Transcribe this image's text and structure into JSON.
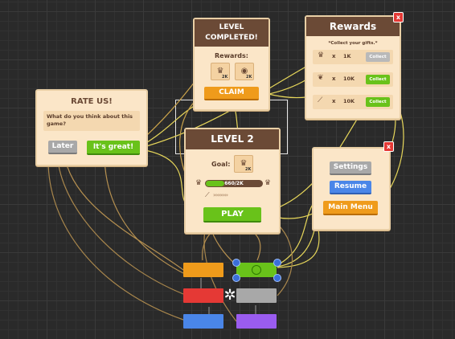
{
  "rate": {
    "title": "RATE US!",
    "question": "What do you think about this game?",
    "later": "Later",
    "great": "It's great!"
  },
  "level_completed": {
    "title": "LEVEL COMPLETED!",
    "rewards_label": "Rewards:",
    "reward1_amount": "2K",
    "reward2_amount": "2K",
    "claim": "CLAIM"
  },
  "rewards": {
    "title": "Rewards",
    "subtitle": "*Collect your gifts.*",
    "rows": [
      {
        "icon": "crown-icon",
        "x": "x",
        "amount": "1K",
        "button": "Collect",
        "color": "#b9b9b9"
      },
      {
        "icon": "leaf-icon",
        "x": "x",
        "amount": "10K",
        "button": "Collect",
        "color": "#69c21a"
      },
      {
        "icon": "feather-icon",
        "x": "x",
        "amount": "10K",
        "button": "Collect",
        "color": "#69c21a"
      }
    ]
  },
  "level2": {
    "title": "LEVEL 2",
    "goal_label": "Goal:",
    "goal_amount": "2K",
    "progress_text": "660/2K",
    "progress_fraction": 0.33,
    "play": "PLAY"
  },
  "pause": {
    "settings": "Settings",
    "resume": "Resume",
    "main_menu": "Main Menu"
  },
  "colors": {
    "panel": "#fbe6c8",
    "header": "#6b4a36",
    "green": "#69c21a",
    "orange": "#ef9b1b",
    "red": "#e53935",
    "blue": "#4a86e8",
    "purple": "#9a5cf0",
    "gray": "#a8a8a8"
  }
}
